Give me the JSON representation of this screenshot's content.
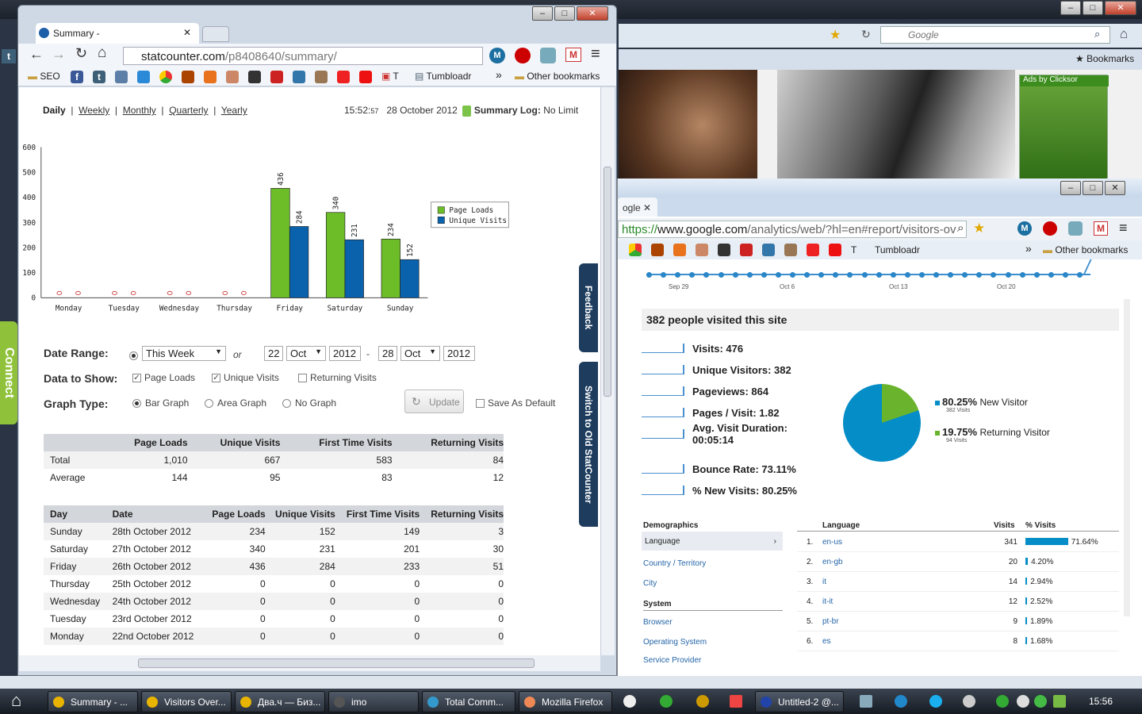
{
  "firefox": {
    "search_placeholder": "Google",
    "bookmarks_label": "Bookmarks",
    "ad_label": "Ads by Clicksor"
  },
  "connect_label": "Connect",
  "analytics": {
    "tab_label": "ogle",
    "url_scheme": "https://",
    "url_host": "www.google.com",
    "url_path": "/analytics/web/?hl=en#report/visitors-ov",
    "bookmark_t": "T",
    "bookmark_tumbloadr": "Tumbloadr",
    "other_bookmarks": "Other bookmarks",
    "x_labels": [
      "Sep 29",
      "Oct 6",
      "Oct 13",
      "Oct 20"
    ],
    "headline": "382 people visited this site",
    "metrics": [
      {
        "label": "Visits: 476"
      },
      {
        "label": "Unique Visitors: 382"
      },
      {
        "label": "Pageviews: 864"
      },
      {
        "label": "Pages / Visit: 1.82"
      },
      {
        "label": "Avg. Visit Duration:",
        "sub": "00:05:14"
      },
      {
        "label": "Bounce Rate: 73.11%"
      },
      {
        "label": "% New Visits: 80.25%"
      }
    ],
    "pie_legend": [
      {
        "pct": "80.25%",
        "label": "New Visitor",
        "sub": "382 Visits",
        "color": "#058dc7"
      },
      {
        "pct": "19.75%",
        "label": "Returning Visitor",
        "sub": "94 Visits",
        "color": "#6ab42d"
      }
    ],
    "demographics_title": "Demographics",
    "demo_language": "Language",
    "demo_country": "Country / Territory",
    "demo_city": "City",
    "system_title": "System",
    "sys_browser": "Browser",
    "sys_os": "Operating System",
    "sys_provider": "Service Provider",
    "lang_header": {
      "language": "Language",
      "visits": "Visits",
      "pct": "% Visits"
    },
    "languages": [
      {
        "n": "1.",
        "name": "en-us",
        "visits": "341",
        "pct": "71.64%",
        "frac": 0.7164
      },
      {
        "n": "2.",
        "name": "en-gb",
        "visits": "20",
        "pct": "4.20%",
        "frac": 0.042
      },
      {
        "n": "3.",
        "name": "it",
        "visits": "14",
        "pct": "2.94%",
        "frac": 0.0294
      },
      {
        "n": "4.",
        "name": "it-it",
        "visits": "12",
        "pct": "2.52%",
        "frac": 0.0252
      },
      {
        "n": "5.",
        "name": "pt-br",
        "visits": "9",
        "pct": "1.89%",
        "frac": 0.0189
      },
      {
        "n": "6.",
        "name": "es",
        "visits": "8",
        "pct": "1.68%",
        "frac": 0.0168
      }
    ]
  },
  "statcounter": {
    "tab_title": "Summary -",
    "url_host": "statcounter.com",
    "url_path": "/p8408640/summary/",
    "bookmarks": {
      "seo": "SEO",
      "t": "T",
      "tumbloadr": "Tumbloadr",
      "other": "Other bookmarks"
    },
    "periods": {
      "daily": "Daily",
      "weekly": "Weekly",
      "monthly": "Monthly",
      "quarterly": "Quarterly",
      "yearly": "Yearly"
    },
    "time": "15:52:",
    "time_sec": "57",
    "date": "28 October 2012",
    "summary_log_label": "Summary Log:",
    "summary_log_value": "No Limit",
    "side_feedback": "Feedback",
    "side_switch": "Switch to Old StatCounter",
    "form": {
      "date_range_label": "Date Range:",
      "range_value": "This Week",
      "or": "or",
      "from_day": "22",
      "from_month": "Oct",
      "from_year": "2012",
      "dash": "-",
      "to_day": "28",
      "to_month": "Oct",
      "to_year": "2012",
      "data_label": "Data to Show:",
      "page_loads": "Page Loads",
      "unique_visits": "Unique Visits",
      "returning_visits": "Returning Visits",
      "graph_label": "Graph Type:",
      "bar_graph": "Bar Graph",
      "area_graph": "Area Graph",
      "no_graph": "No Graph",
      "update": "Update",
      "save_default": "Save As Default"
    },
    "summary_table": {
      "headers": [
        "",
        "Page Loads",
        "Unique Visits",
        "First Time Visits",
        "Returning Visits"
      ],
      "rows": [
        [
          "Total",
          "1,010",
          "667",
          "583",
          "84"
        ],
        [
          "Average",
          "144",
          "95",
          "83",
          "12"
        ]
      ]
    },
    "day_table": {
      "headers": [
        "Day",
        "Date",
        "Page Loads",
        "Unique Visits",
        "First Time Visits",
        "Returning Visits"
      ],
      "rows": [
        [
          "Sunday",
          "28th October 2012",
          "234",
          "152",
          "149",
          "3"
        ],
        [
          "Saturday",
          "27th October 2012",
          "340",
          "231",
          "201",
          "30"
        ],
        [
          "Friday",
          "26th October 2012",
          "436",
          "284",
          "233",
          "51"
        ],
        [
          "Thursday",
          "25th October 2012",
          "0",
          "0",
          "0",
          "0"
        ],
        [
          "Wednesday",
          "24th October 2012",
          "0",
          "0",
          "0",
          "0"
        ],
        [
          "Tuesday",
          "23rd October 2012",
          "0",
          "0",
          "0",
          "0"
        ],
        [
          "Monday",
          "22nd October 2012",
          "0",
          "0",
          "0",
          "0"
        ]
      ]
    }
  },
  "chart_data": {
    "type": "bar",
    "categories": [
      "Monday",
      "Tuesday",
      "Wednesday",
      "Thursday",
      "Friday",
      "Saturday",
      "Sunday"
    ],
    "series": [
      {
        "name": "Page Loads",
        "values": [
          0,
          0,
          0,
          0,
          436,
          340,
          234
        ],
        "color": "#6cbd28"
      },
      {
        "name": "Unique Visits",
        "values": [
          0,
          0,
          0,
          0,
          284,
          231,
          152
        ],
        "color": "#0a62ac"
      }
    ],
    "ylim": [
      0,
      600
    ],
    "yticks": [
      0,
      100,
      200,
      300,
      400,
      500,
      600
    ],
    "legend_position": "right"
  },
  "taskbar": {
    "items": [
      "Summary - ...",
      "Visitors Over...",
      "Два.ч — Биз...",
      "imo",
      "Total Comm...",
      "Mozilla Firefox",
      "Untitled-2 @..."
    ],
    "clock": "15:56"
  }
}
